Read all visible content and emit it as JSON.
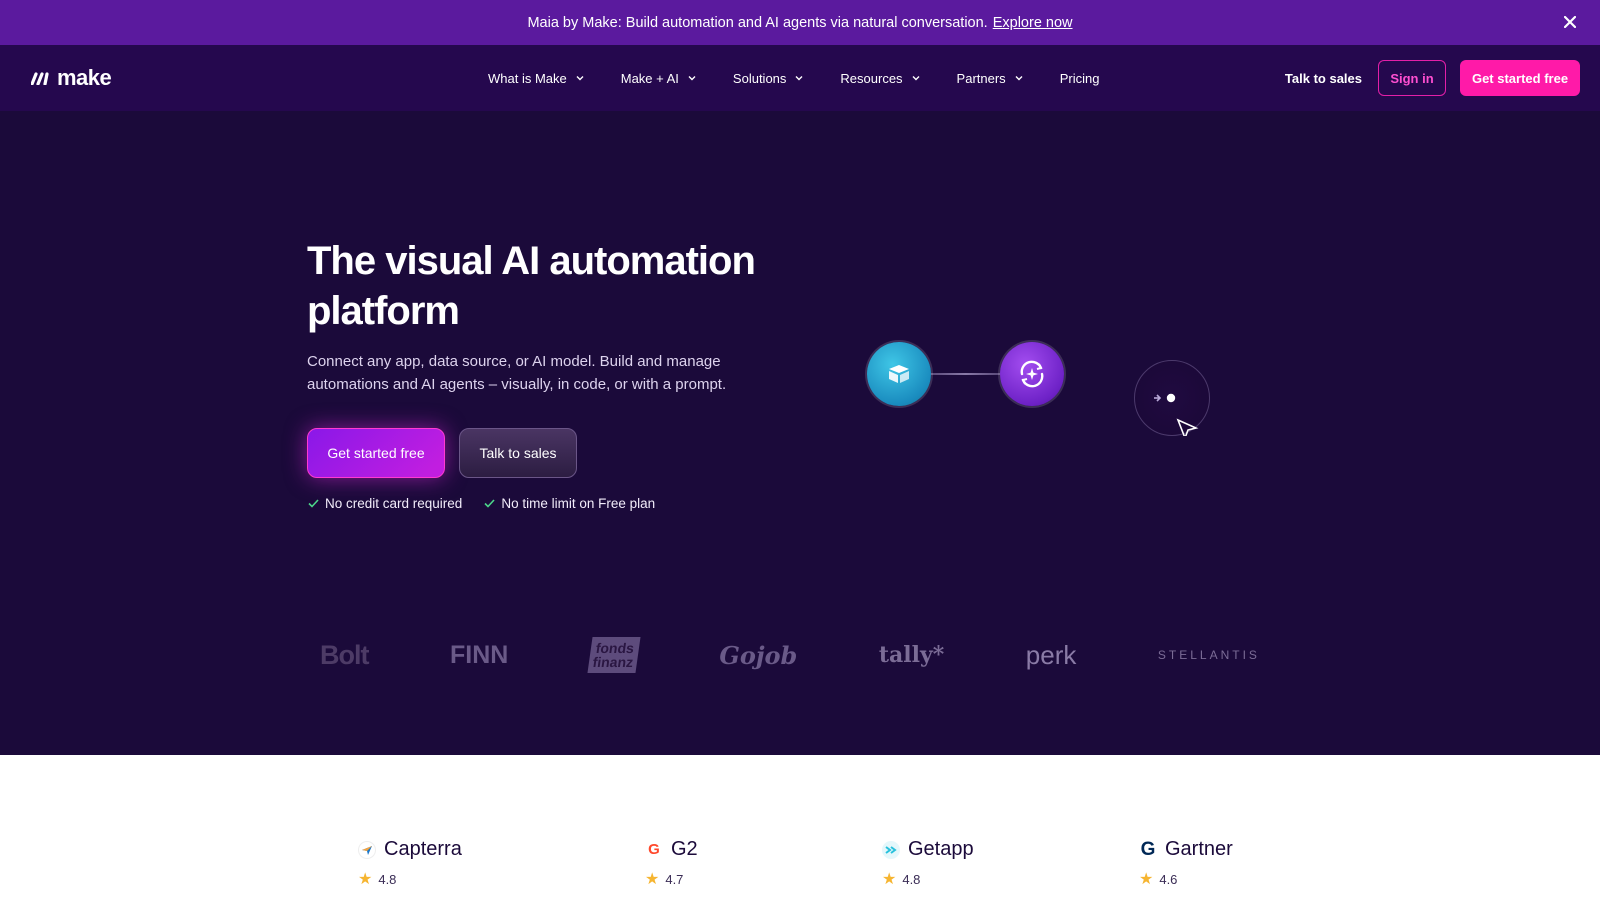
{
  "announcement": {
    "text": "Maia by Make: Build automation and AI agents via natural conversation.",
    "link": "Explore now",
    "close_icon": "close-icon"
  },
  "brand": {
    "name": "make"
  },
  "nav": {
    "items": [
      {
        "label": "What is Make",
        "has_dropdown": true
      },
      {
        "label": "Make + AI",
        "has_dropdown": true
      },
      {
        "label": "Solutions",
        "has_dropdown": true
      },
      {
        "label": "Resources",
        "has_dropdown": true
      },
      {
        "label": "Partners",
        "has_dropdown": true
      },
      {
        "label": "Pricing",
        "has_dropdown": false
      }
    ],
    "talk_to_sales": "Talk to sales",
    "sign_in": "Sign in",
    "get_started": "Get started free"
  },
  "hero": {
    "title": "The visual AI automation platform",
    "subtitle": "Connect any app, data source, or AI model. Build and manage automations and AI agents – visually, in code, or with a prompt.",
    "primary_cta": "Get started free",
    "secondary_cta": "Talk to sales",
    "checks": [
      "No credit card required",
      "No time limit on Free plan"
    ]
  },
  "logos": [
    "Bolt",
    "FINN",
    "fonds finanz",
    "Gojob",
    "tally*",
    "perk",
    "STELLANTIS"
  ],
  "ratings": [
    {
      "name": "Capterra",
      "score": "4.8",
      "icon": "capterra-icon"
    },
    {
      "name": "G2",
      "score": "4.7",
      "icon": "g2-icon"
    },
    {
      "name": "Getapp",
      "score": "4.8",
      "icon": "getapp-icon"
    },
    {
      "name": "Gartner",
      "score": "4.6",
      "icon": "gartner-icon"
    }
  ],
  "colors": {
    "announcement_bg": "#5b1a9e",
    "nav_bg": "#25084e",
    "hero_bg": "#1b0a3a",
    "accent_pink": "#ff1aa8",
    "primary_purple": "#8a18e8"
  }
}
